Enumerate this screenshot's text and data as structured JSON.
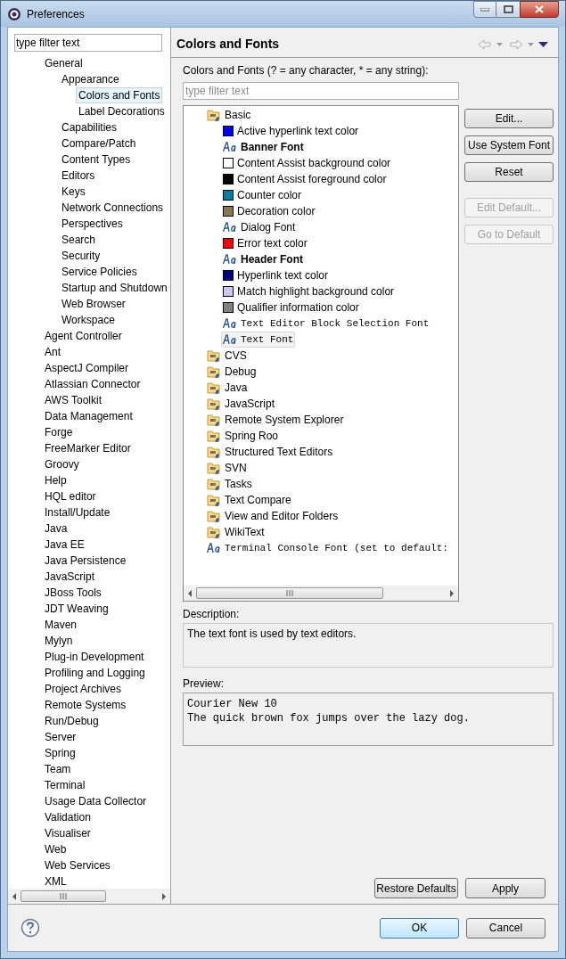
{
  "window": {
    "title": "Preferences"
  },
  "sidebar": {
    "filter": {
      "value": "type filter text"
    },
    "items": [
      {
        "label": "General",
        "selected": false,
        "children": [
          {
            "label": "Appearance",
            "selected": false,
            "children": [
              {
                "label": "Colors and Fonts",
                "selected": true
              },
              {
                "label": "Label Decorations",
                "selected": false
              }
            ]
          },
          {
            "label": "Capabilities",
            "selected": false
          },
          {
            "label": "Compare/Patch",
            "selected": false
          },
          {
            "label": "Content Types",
            "selected": false
          },
          {
            "label": "Editors",
            "selected": false
          },
          {
            "label": "Keys",
            "selected": false
          },
          {
            "label": "Network Connections",
            "selected": false
          },
          {
            "label": "Perspectives",
            "selected": false
          },
          {
            "label": "Search",
            "selected": false
          },
          {
            "label": "Security",
            "selected": false
          },
          {
            "label": "Service Policies",
            "selected": false
          },
          {
            "label": "Startup and Shutdown",
            "selected": false
          },
          {
            "label": "Web Browser",
            "selected": false
          },
          {
            "label": "Workspace",
            "selected": false
          }
        ]
      },
      {
        "label": "Agent Controller",
        "selected": false
      },
      {
        "label": "Ant",
        "selected": false
      },
      {
        "label": "AspectJ Compiler",
        "selected": false
      },
      {
        "label": "Atlassian Connector",
        "selected": false
      },
      {
        "label": "AWS Toolkit",
        "selected": false
      },
      {
        "label": "Data Management",
        "selected": false
      },
      {
        "label": "Forge",
        "selected": false
      },
      {
        "label": "FreeMarker Editor",
        "selected": false
      },
      {
        "label": "Groovy",
        "selected": false
      },
      {
        "label": "Help",
        "selected": false
      },
      {
        "label": "HQL editor",
        "selected": false
      },
      {
        "label": "Install/Update",
        "selected": false
      },
      {
        "label": "Java",
        "selected": false
      },
      {
        "label": "Java EE",
        "selected": false
      },
      {
        "label": "Java Persistence",
        "selected": false
      },
      {
        "label": "JavaScript",
        "selected": false
      },
      {
        "label": "JBoss Tools",
        "selected": false
      },
      {
        "label": "JDT Weaving",
        "selected": false
      },
      {
        "label": "Maven",
        "selected": false
      },
      {
        "label": "Mylyn",
        "selected": false
      },
      {
        "label": "Plug-in Development",
        "selected": false
      },
      {
        "label": "Profiling and Logging",
        "selected": false
      },
      {
        "label": "Project Archives",
        "selected": false
      },
      {
        "label": "Remote Systems",
        "selected": false
      },
      {
        "label": "Run/Debug",
        "selected": false
      },
      {
        "label": "Server",
        "selected": false
      },
      {
        "label": "Spring",
        "selected": false
      },
      {
        "label": "Team",
        "selected": false
      },
      {
        "label": "Terminal",
        "selected": false
      },
      {
        "label": "Usage Data Collector",
        "selected": false
      },
      {
        "label": "Validation",
        "selected": false
      },
      {
        "label": "Visualiser",
        "selected": false
      },
      {
        "label": "Web",
        "selected": false
      },
      {
        "label": "Web Services",
        "selected": false
      },
      {
        "label": "XML",
        "selected": false
      }
    ]
  },
  "page": {
    "title": "Colors and Fonts",
    "filter_label": "Colors and Fonts (? = any character, * = any string):",
    "filter": {
      "placeholder": "type filter text"
    },
    "tree": [
      {
        "label": "Basic",
        "kind": "folder",
        "selected": false,
        "children": [
          {
            "label": "Active hyperlink text color",
            "kind": "color",
            "color": "#0000ff",
            "selected": false
          },
          {
            "label": "Banner Font",
            "kind": "bold",
            "selected": false
          },
          {
            "label": "Content Assist background color",
            "kind": "color",
            "color": "#ffffff",
            "selected": false
          },
          {
            "label": "Content Assist foreground color",
            "kind": "color",
            "color": "#000000",
            "selected": false
          },
          {
            "label": "Counter color",
            "kind": "color",
            "color": "#0080a0",
            "selected": false
          },
          {
            "label": "Decoration color",
            "kind": "color",
            "color": "#8b7a4f",
            "selected": false
          },
          {
            "label": "Dialog Font",
            "kind": "font",
            "selected": false
          },
          {
            "label": "Error text color",
            "kind": "color",
            "color": "#ff0000",
            "selected": false
          },
          {
            "label": "Header Font",
            "kind": "bold",
            "selected": false
          },
          {
            "label": "Hyperlink text color",
            "kind": "color",
            "color": "#000080",
            "selected": false
          },
          {
            "label": "Match highlight background color",
            "kind": "color",
            "color": "#c8c8f0",
            "selected": false
          },
          {
            "label": "Qualifier information color",
            "kind": "color",
            "color": "#808080",
            "selected": false
          },
          {
            "label": "Text Editor Block Selection Font",
            "kind": "mono",
            "selected": false
          },
          {
            "label": "Text Font",
            "kind": "mono",
            "selected": true
          }
        ]
      },
      {
        "label": "CVS",
        "kind": "folder",
        "selected": false
      },
      {
        "label": "Debug",
        "kind": "folder",
        "selected": false
      },
      {
        "label": "Java",
        "kind": "folder",
        "selected": false
      },
      {
        "label": "JavaScript",
        "kind": "folder",
        "selected": false
      },
      {
        "label": "Remote System Explorer",
        "kind": "folder",
        "selected": false
      },
      {
        "label": "Spring Roo",
        "kind": "folder",
        "selected": false
      },
      {
        "label": "Structured Text Editors",
        "kind": "folder",
        "selected": false
      },
      {
        "label": "SVN",
        "kind": "folder",
        "selected": false
      },
      {
        "label": "Tasks",
        "kind": "folder",
        "selected": false
      },
      {
        "label": "Text Compare",
        "kind": "folder",
        "selected": false
      },
      {
        "label": "View and Editor Folders",
        "kind": "folder",
        "selected": false
      },
      {
        "label": "WikiText",
        "kind": "folder",
        "selected": false
      },
      {
        "label": "Terminal Console Font (set to default:",
        "kind": "mono",
        "selected": false
      }
    ],
    "side_buttons": [
      {
        "label": "Edit...",
        "disabled": false
      },
      {
        "label": "Use System Font",
        "disabled": false
      },
      {
        "label": "Reset",
        "disabled": false
      },
      {
        "label": "Edit Default...",
        "disabled": true
      },
      {
        "label": "Go to Default",
        "disabled": true
      }
    ],
    "description_label": "Description:",
    "description": "The text font is used by text editors.",
    "preview_label": "Preview:",
    "preview": [
      "Courier New 10",
      "The quick brown fox jumps over the lazy dog."
    ],
    "buttons": [
      "Restore Defaults",
      "Apply"
    ]
  },
  "footer": {
    "buttons": [
      {
        "label": "OK",
        "default": true
      },
      {
        "label": "Cancel",
        "default": false
      }
    ]
  }
}
